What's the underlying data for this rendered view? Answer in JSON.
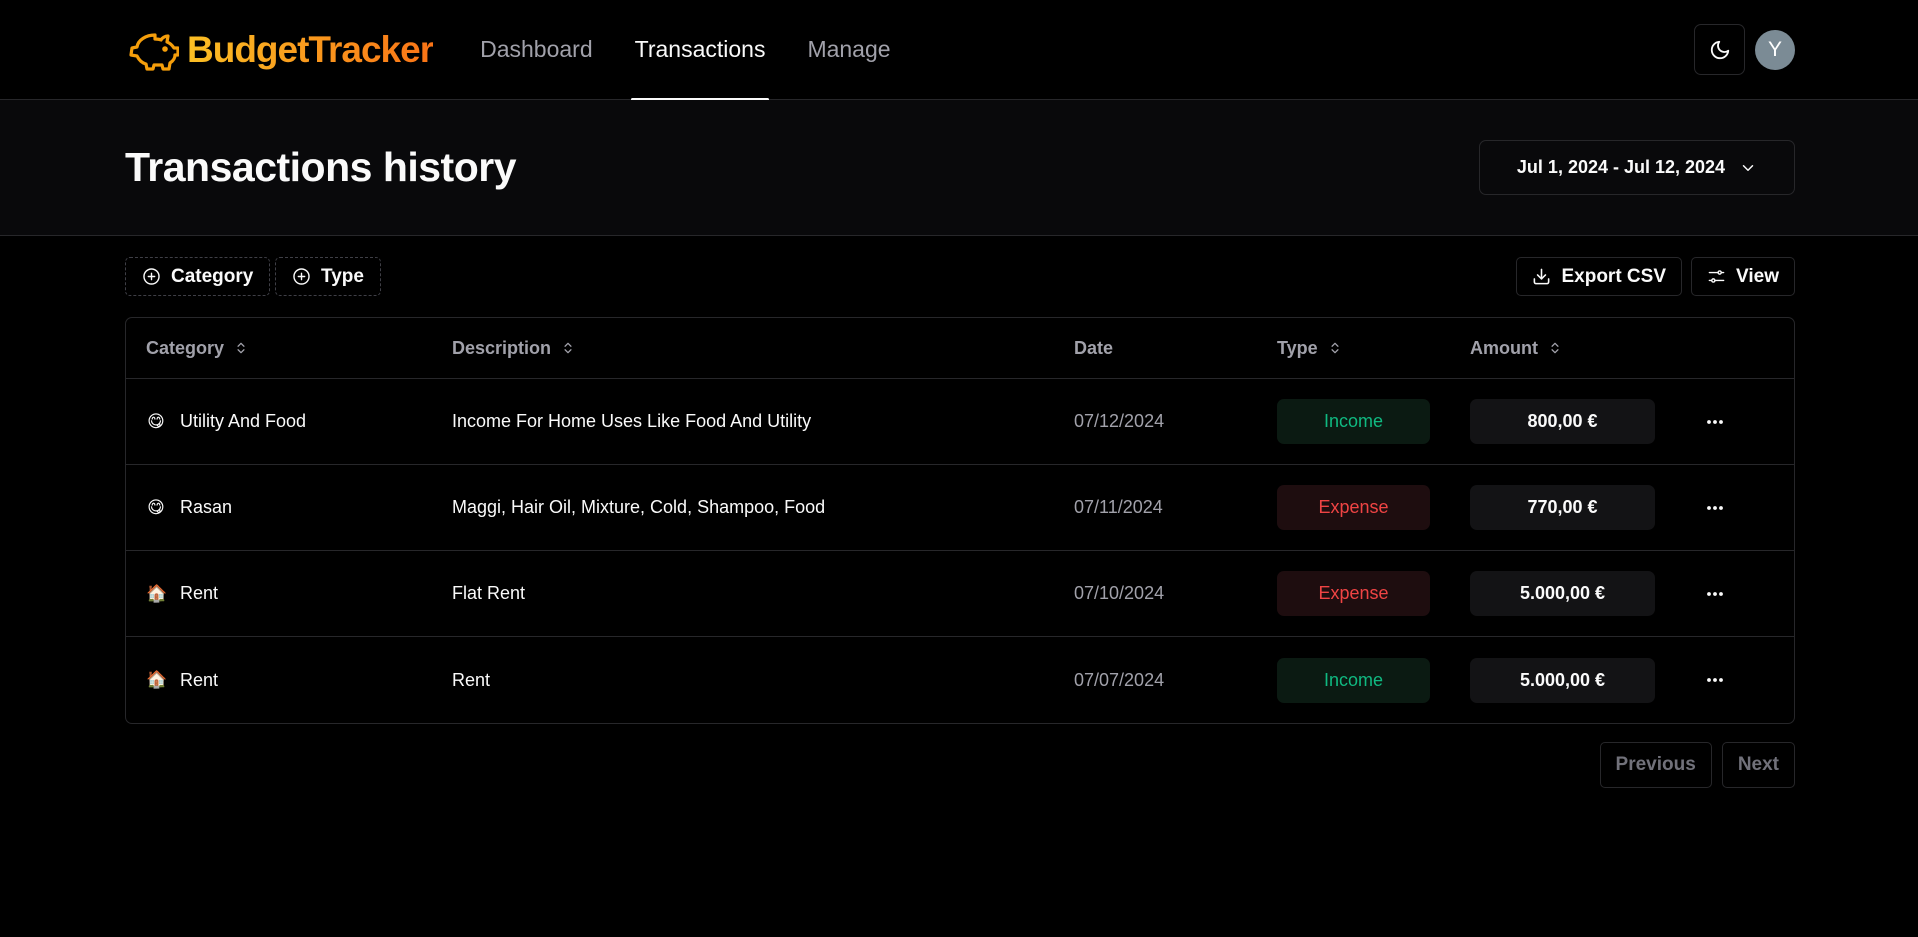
{
  "app": {
    "name": "BudgetTracker",
    "brand_colors": [
      "#fbbf24",
      "#f97316"
    ]
  },
  "nav": {
    "links": [
      {
        "label": "Dashboard",
        "active": false
      },
      {
        "label": "Transactions",
        "active": true
      },
      {
        "label": "Manage",
        "active": false
      }
    ],
    "theme_icon": "moon-icon",
    "avatar_initial": "Y"
  },
  "header": {
    "title": "Transactions history",
    "date_range": "Jul 1, 2024 - Jul 12, 2024"
  },
  "toolbar": {
    "filters": [
      {
        "label": "Category",
        "icon": "plus-circle-icon"
      },
      {
        "label": "Type",
        "icon": "plus-circle-icon"
      }
    ],
    "export_label": "Export CSV",
    "view_label": "View"
  },
  "table": {
    "columns": [
      {
        "label": "Category",
        "sortable": true
      },
      {
        "label": "Description",
        "sortable": true
      },
      {
        "label": "Date",
        "sortable": false
      },
      {
        "label": "Type",
        "sortable": true
      },
      {
        "label": "Amount",
        "sortable": true
      }
    ],
    "rows": [
      {
        "emoji": "😋",
        "category": "Utility And Food",
        "description": "Income For Home Uses Like Food And Utility",
        "date": "07/12/2024",
        "type": "Income",
        "amount": "800,00 €"
      },
      {
        "emoji": "😋",
        "category": "Rasan",
        "description": "Maggi, Hair Oil, Mixture, Cold, Shampoo, Food",
        "date": "07/11/2024",
        "type": "Expense",
        "amount": "770,00 €"
      },
      {
        "emoji": "🏠",
        "category": "Rent",
        "description": "Flat Rent",
        "date": "07/10/2024",
        "type": "Expense",
        "amount": "5.000,00 €"
      },
      {
        "emoji": "🏠",
        "category": "Rent",
        "description": "Rent",
        "date": "07/07/2024",
        "type": "Income",
        "amount": "5.000,00 €"
      }
    ]
  },
  "pagination": {
    "previous_label": "Previous",
    "next_label": "Next"
  },
  "status_colors": {
    "income": "#10b981",
    "expense": "#ef4444"
  }
}
